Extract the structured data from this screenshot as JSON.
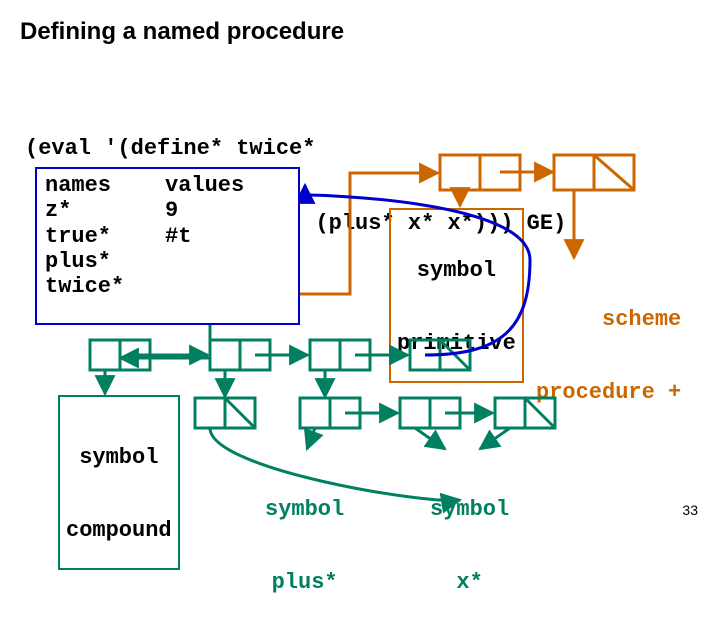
{
  "title": "Defining a named procedure",
  "code_line_1": "(eval '(define* twice*",
  "code_line_2": "        (lambda* (x*) (plus* x* x*))) GE)",
  "env": {
    "headers": {
      "names": "names",
      "values": "values"
    },
    "rows": [
      {
        "name": "  z*",
        "value": "9"
      },
      {
        "name": "true*",
        "value": "#t"
      },
      {
        "name": "plus*",
        "value": ""
      },
      {
        "name": "twice*",
        "value": ""
      }
    ]
  },
  "labels": {
    "sym_primitive_l1": "symbol",
    "sym_primitive_l2": "primitive",
    "scheme_l1": "scheme",
    "scheme_l2": "procedure +",
    "sym_compound_l1": "symbol",
    "sym_compound_l2": "compound",
    "sym_plus_l1": "symbol",
    "sym_plus_l2": "plus*",
    "sym_x_l1": "symbol",
    "sym_x_l2": "x*"
  },
  "colors": {
    "orange": "#cc6600",
    "green": "#008060",
    "blue": "#0000cc",
    "black": "#000"
  },
  "slide_number": "33"
}
